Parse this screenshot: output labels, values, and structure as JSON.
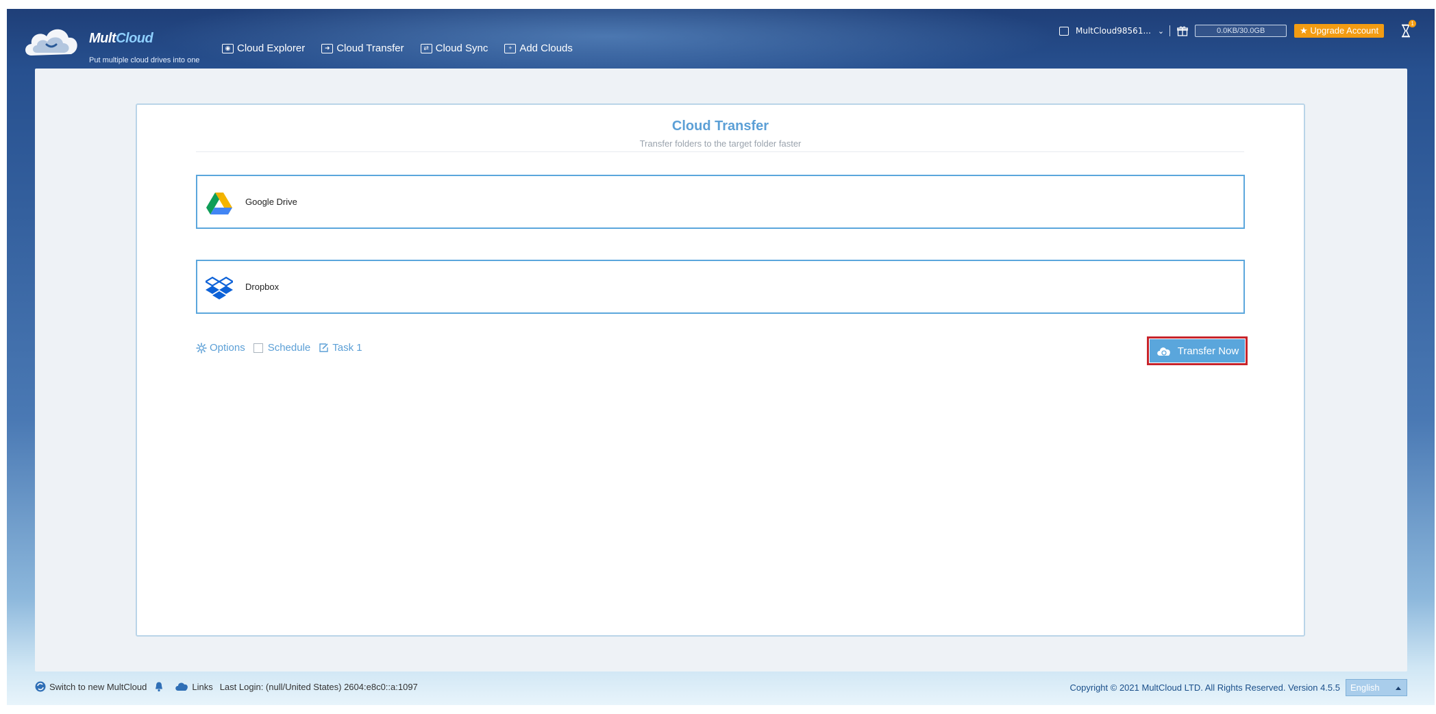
{
  "app": {
    "name_main": "Mult",
    "name_accent": "Cloud",
    "tagline": "Put multiple cloud drives into one"
  },
  "nav": [
    {
      "label": "Cloud Explorer",
      "icon": "cloud-explorer-icon"
    },
    {
      "label": "Cloud Transfer",
      "icon": "cloud-transfer-icon"
    },
    {
      "label": "Cloud Sync",
      "icon": "cloud-sync-icon"
    },
    {
      "label": "Add Clouds",
      "icon": "add-clouds-icon"
    }
  ],
  "account": {
    "name": "MultCloud98561...",
    "quota": "0.0KB/30.0GB",
    "upgrade_label": "★ Upgrade Account",
    "notification_count": "1"
  },
  "transfer": {
    "title": "Cloud Transfer",
    "subtitle": "Transfer folders to the target folder faster",
    "source": {
      "label": "Google Drive",
      "icon": "google-drive-icon"
    },
    "target": {
      "label": "Dropbox",
      "icon": "dropbox-icon"
    },
    "options_label": "Options",
    "schedule_label": "Schedule",
    "schedule_checked": false,
    "task_label": "Task 1",
    "transfer_button": "Transfer Now"
  },
  "footer": {
    "switch_label": "Switch to new MultCloud",
    "links_label": "Links",
    "last_login": "Last Login: (null/United States) 2604:e8c0::a:1097",
    "copyright": "Copyright © 2021 MultCloud LTD. All Rights Reserved. Version 4.5.5",
    "language": "English"
  },
  "colors": {
    "accent": "#5aa6dc",
    "header": "#27508f",
    "upgrade": "#f39c12",
    "highlight": "#c7242b"
  }
}
